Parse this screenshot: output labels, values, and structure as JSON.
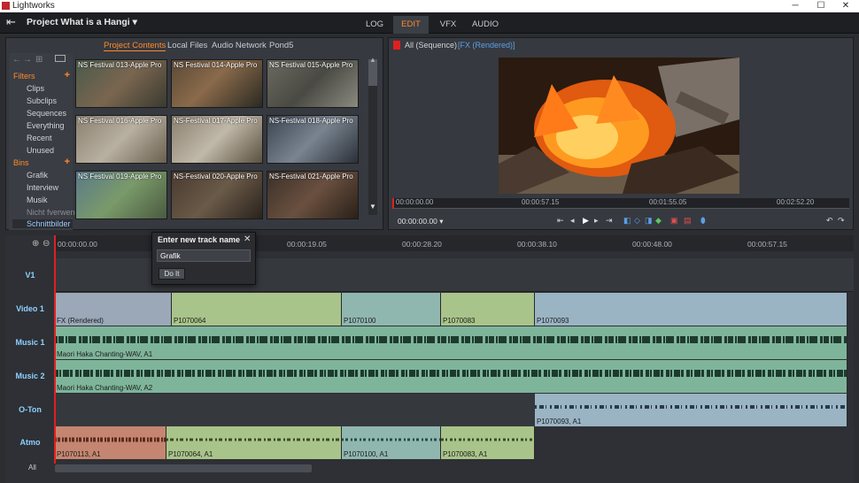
{
  "window": {
    "title": "Lightworks",
    "minimize": "─",
    "maximize": "☐",
    "close": "✕"
  },
  "menubar": {
    "project_title": "Project What is a Hangi ▾",
    "tabs": [
      "LOG",
      "EDIT",
      "VFX",
      "AUDIO"
    ],
    "active_tab": "EDIT"
  },
  "browser": {
    "tabs": [
      "Project Contents",
      "Local Files",
      "Audio Network",
      "Pond5"
    ],
    "active_tab": "Project Contents",
    "filters_header": "Filters",
    "filters": [
      "Clips",
      "Subclips",
      "Sequences",
      "Everything",
      "Recent",
      "Unused"
    ],
    "bins_header": "Bins",
    "bins": [
      "Grafik",
      "Interview",
      "Musik",
      "Nicht fverwenc",
      "Schnittbilder"
    ],
    "selected_bin": "Schnittbilder",
    "thumbnails": [
      "NS Festival 013-Apple Pro",
      "NS Festival 014-Apple Pro",
      "NS Festival 015-Apple Pro",
      "NS Festival 016-Apple Pro",
      "NS-Festival 017-Apple Pro",
      "NS-Festival 018-Apple Pro",
      "NS Festival 019-Apple Pro",
      "NS-Festival 020-Apple Pro",
      "NS-Festival 021-Apple Pro"
    ]
  },
  "viewer": {
    "title": "All (Sequence)",
    "tag": "[FX (Rendered)]",
    "ruler": [
      "00:00:00.00",
      "00:00:57.15",
      "00:01:55.05",
      "00:02:52.20"
    ],
    "timecode": "00:00:00.00 ▾"
  },
  "timeline": {
    "ruler": [
      "00:00:00.00",
      "00:00:19.05",
      "00:00:28.20",
      "00:00:38.10",
      "00:00:48.00",
      "00:00:57.15"
    ],
    "tracks": [
      "V1",
      "Video 1",
      "Music 1",
      "Music 2",
      "O-Ton",
      "Atmo"
    ],
    "all_label": "All",
    "video_clips": [
      "FX (Rendered)",
      "P1070064",
      "P1070100",
      "P1070083",
      "P1070093"
    ],
    "music1_clip": "Maori Haka Chanting-WAV, A1",
    "music2_clip": "Maori Haka Chanting-WAV, A2",
    "oton_clip": "P1070093, A1",
    "atmo_clips": [
      "P1070113, A1",
      "P1070064, A1",
      "P1070100, A1",
      "P1070083, A1"
    ]
  },
  "dialog": {
    "title": "Enter new track name",
    "close": "✕",
    "value": "Grafik",
    "button": "Do It"
  },
  "colors": {
    "accent": "#ff8a2a",
    "track_label": "#8fd0ff",
    "video_clip_a": "#9aa8b8",
    "video_clip_b": "#a9c48a",
    "video_clip_c": "#8fb7b0",
    "audio_clip": "#7eb59a",
    "atmo_red": "#c48670"
  }
}
